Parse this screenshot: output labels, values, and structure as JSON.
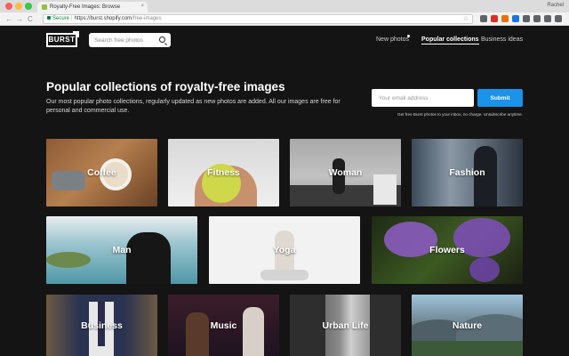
{
  "browser": {
    "tab_title": "Royalty-Free Images: Browse",
    "tab_close": "×",
    "profile_name": "Rachel",
    "nav": {
      "back": "←",
      "forward": "→",
      "reload": "C"
    },
    "url_secure_label": "Secure",
    "url_separator": "|",
    "url_host": "https://burst.shopify.com",
    "url_path": "/free-images",
    "star": "☆",
    "extension_colors": [
      "#5f6368",
      "#d93025",
      "#e8710a",
      "#1a73e8",
      "#5f6368",
      "#5f6368",
      "#5f6368",
      "#5f6368"
    ]
  },
  "header": {
    "logo_text": "BURST",
    "search_placeholder": "Search free photos",
    "nav": {
      "new_photos": "New photos",
      "popular_collections": "Popular collections",
      "business_ideas": "Business ideas"
    }
  },
  "hero": {
    "title": "Popular collections of royalty-free images",
    "description": "Our most popular photo collections, regularly updated as new photos are added. All our images are free for personal and commercial use.",
    "email_placeholder": "Your email address",
    "submit_label": "Submit",
    "disclaimer": "Get free Burst photos to your inbox, no charge. Unsubscribe anytime."
  },
  "collections": [
    {
      "label": "Coffee"
    },
    {
      "label": "Fitness"
    },
    {
      "label": "Woman"
    },
    {
      "label": "Fashion"
    },
    {
      "label": "Man"
    },
    {
      "label": "Yoga"
    },
    {
      "label": "Flowers"
    },
    {
      "label": "Business"
    },
    {
      "label": "Music"
    },
    {
      "label": "Urban Life"
    },
    {
      "label": "Nature"
    }
  ],
  "colors": {
    "page_background": "#141414",
    "accent": "#1a93e8",
    "secure_green": "#0b8043"
  }
}
